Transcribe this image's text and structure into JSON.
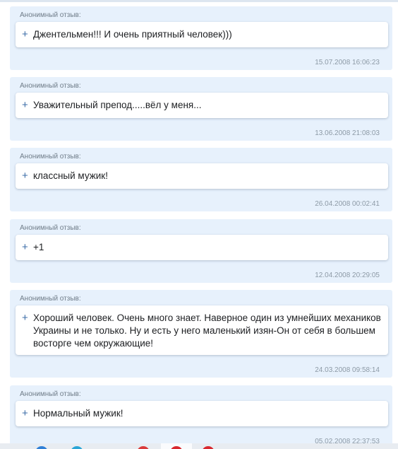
{
  "reviews": [
    {
      "label": "Анонимный отзыв:",
      "text": "Джентельмен!!! И очень приятный человек)))",
      "date": "15.07.2008 16:06:23"
    },
    {
      "label": "Анонимный отзыв:",
      "text": "Уважительный препод.....вёл у меня...",
      "date": "13.06.2008 21:08:03"
    },
    {
      "label": "Анонимный отзыв:",
      "text": "классный мужик!",
      "date": "26.04.2008 00:02:41"
    },
    {
      "label": "Анонимный отзыв:",
      "text": "+1",
      "date": "12.04.2008 20:29:05"
    },
    {
      "label": "Анонимный отзыв:",
      "text": "Хороший человек. Очень много знает. Наверное один из умнейших механиков Украины и не только. Ну и есть у него маленький изян-Он от себя в большем восторге чем окружающие!",
      "date": "24.03.2008 09:58:14"
    },
    {
      "label": "Анонимный отзыв:",
      "text": "Нормальный мужик!",
      "date": "05.02.2008 22:37:53"
    }
  ],
  "plus_symbol": "+",
  "colors": {
    "card_background": "#e7f1fc",
    "plus_accent": "#3d6ea8",
    "date_text": "#8d9aa6"
  },
  "taskbar": {
    "icons": [
      "browser-app-icon",
      "telegram-app-icon",
      "red-app-icon",
      "opera-app-icon",
      "pinned-app-icon"
    ]
  }
}
